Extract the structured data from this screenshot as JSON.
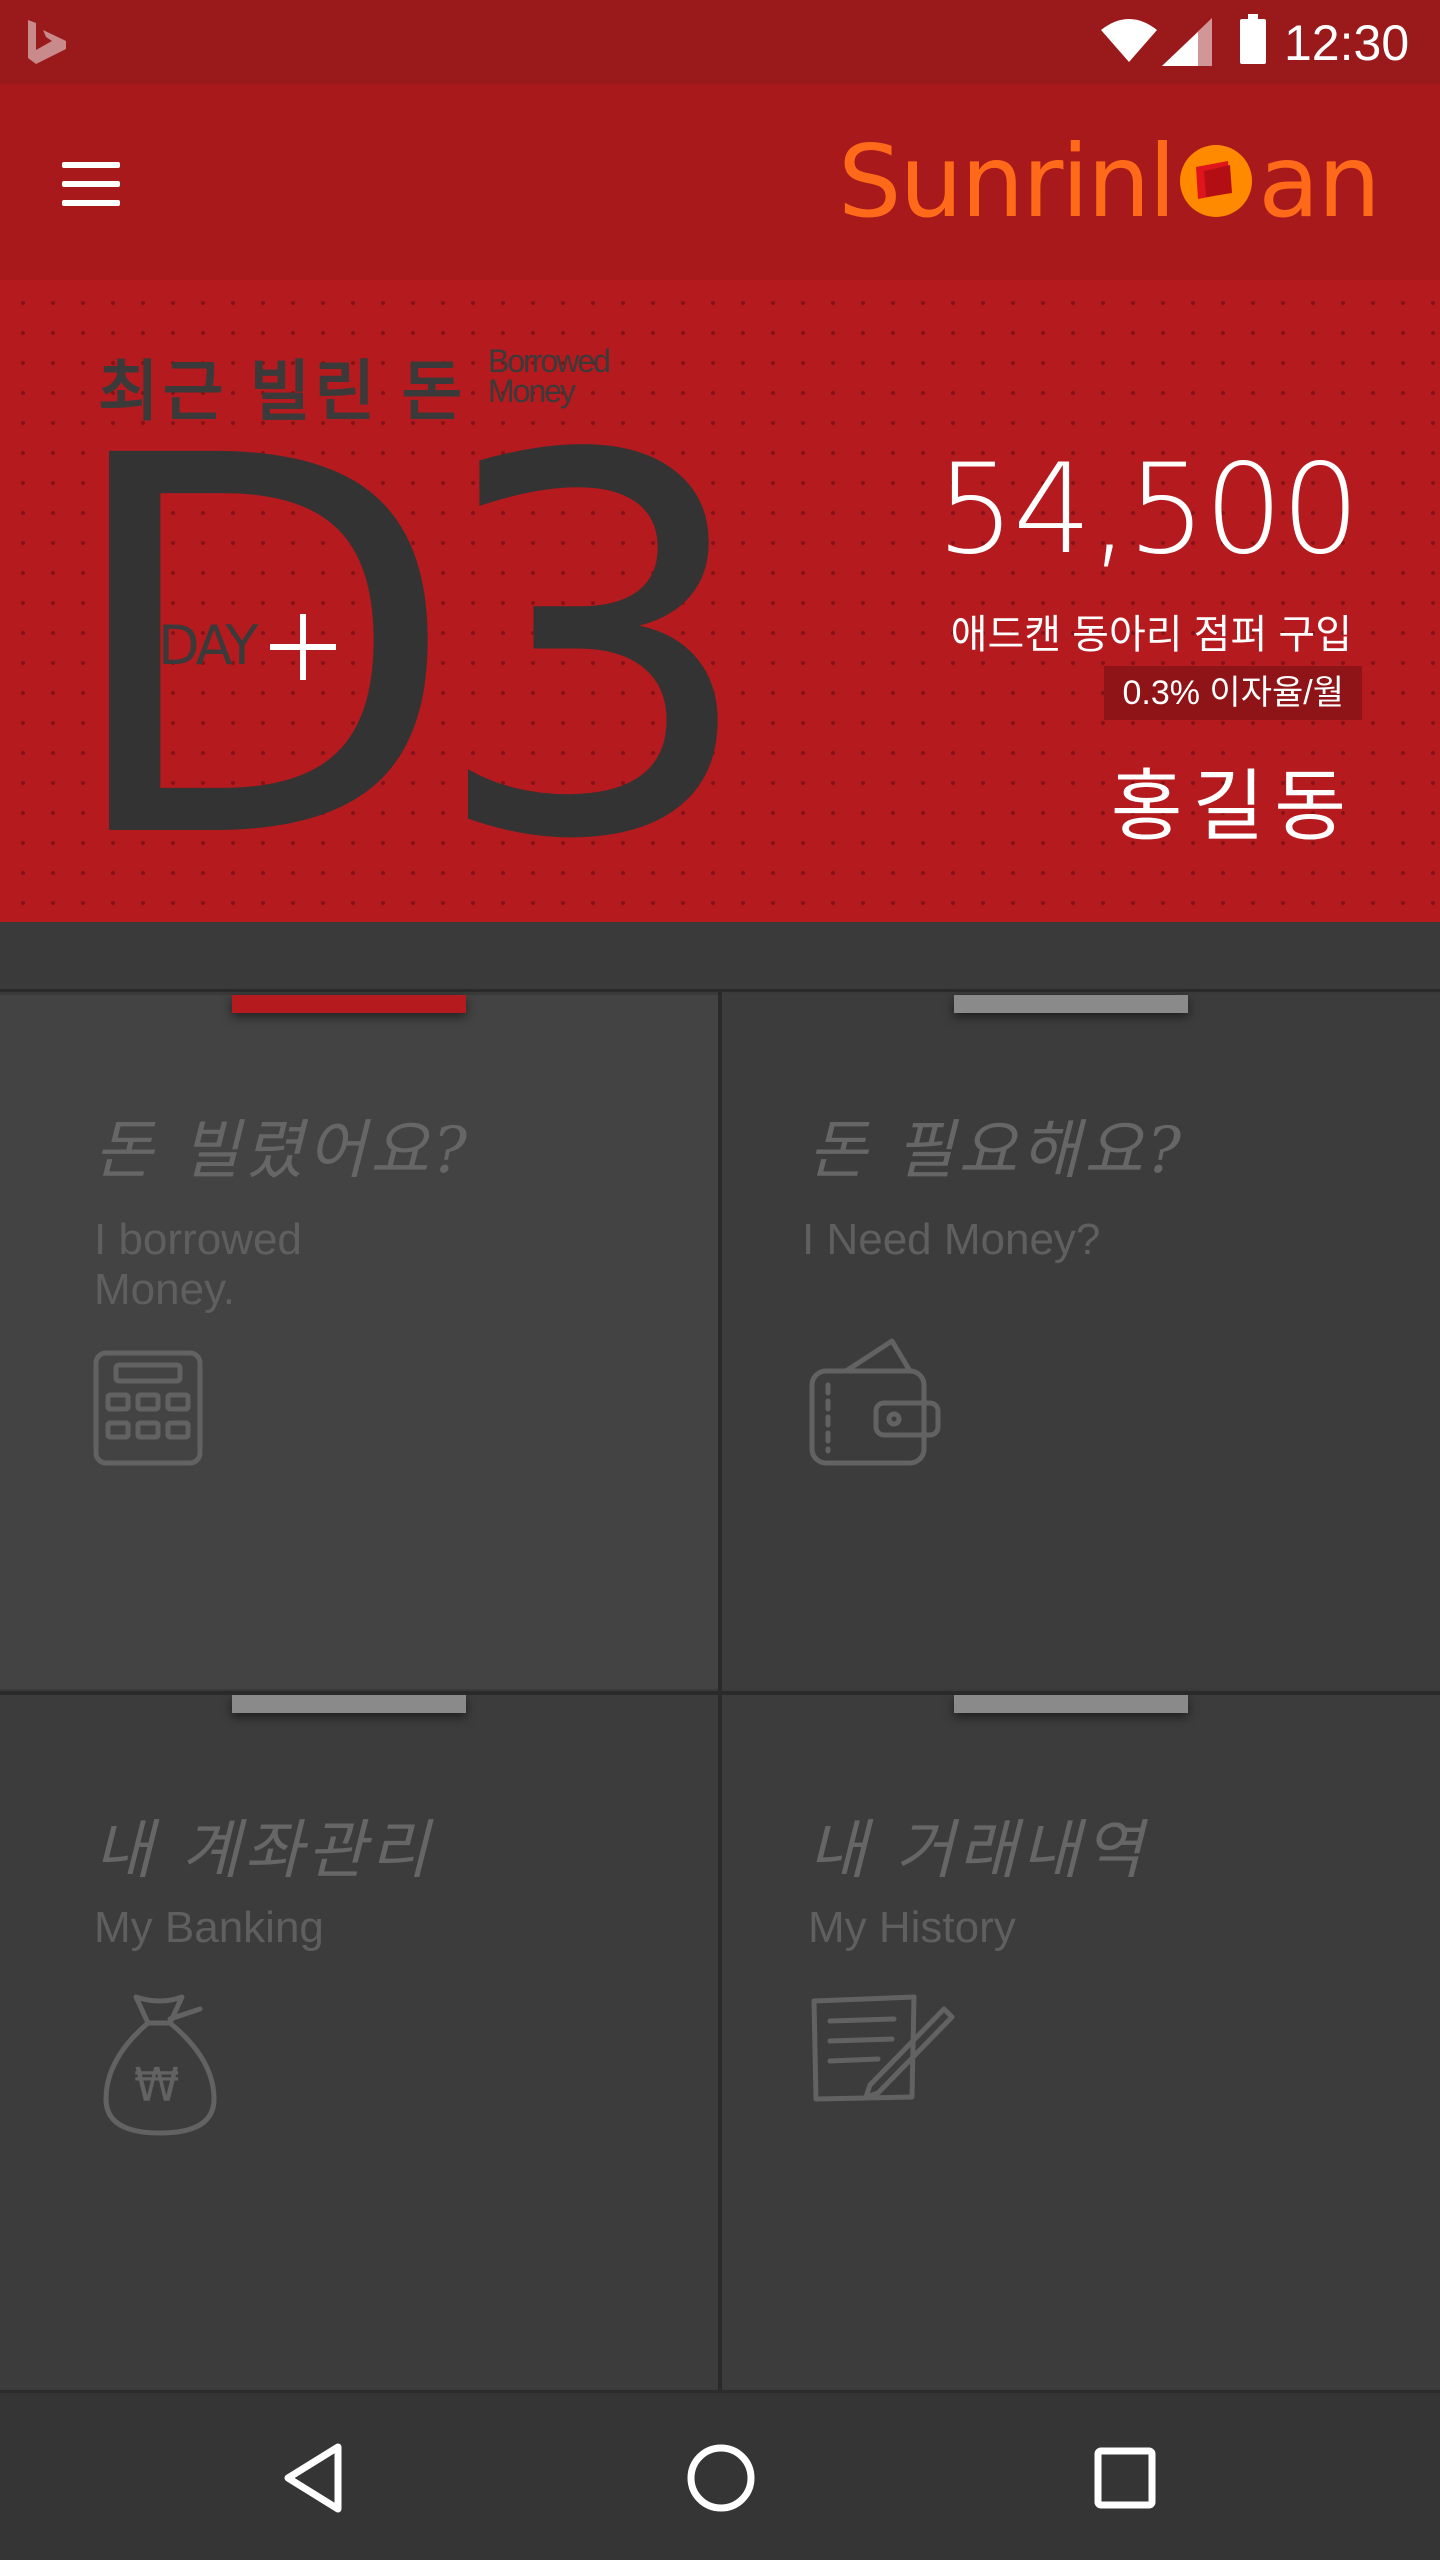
{
  "status_bar": {
    "time": "12:30",
    "icons": [
      "bing-icon",
      "wifi-icon",
      "signal-icon",
      "battery-icon"
    ]
  },
  "app_bar": {
    "menu_icon": "hamburger-menu-icon",
    "logo": "SunrinLoan"
  },
  "hero": {
    "title": "최근 빌린 돈",
    "subtitle": "Borrowed Money",
    "dday_value": "D3",
    "day_label": "DAY",
    "amount": "54,500",
    "item_name": "애드캔 동아리 점퍼 구입",
    "rate": "0.3% 이자율/월",
    "borrower": "홍길동"
  },
  "tiles": [
    {
      "korean": "돈 빌렸어요?",
      "english": "I borrowed Money.",
      "icon": "calculator-icon",
      "active": true
    },
    {
      "korean": "돈 필요해요?",
      "english": "I Need Money?",
      "icon": "wallet-icon",
      "active": false
    },
    {
      "korean": "내 계좌관리",
      "english": "My Banking",
      "icon": "money-bag-icon",
      "active": false
    },
    {
      "korean": "내 거래내역",
      "english": "My History",
      "icon": "history-note-icon",
      "active": false
    }
  ],
  "colors": {
    "status_bar": "#9a1a1c",
    "app_bar": "#a8191c",
    "hero": "#b51a1e",
    "logo_orange": "#ff6a1a",
    "tile_bg": "#3c3c3c",
    "accent_indicator": "#b51a1e"
  },
  "nav": [
    "back-icon",
    "home-icon",
    "recents-icon"
  ]
}
